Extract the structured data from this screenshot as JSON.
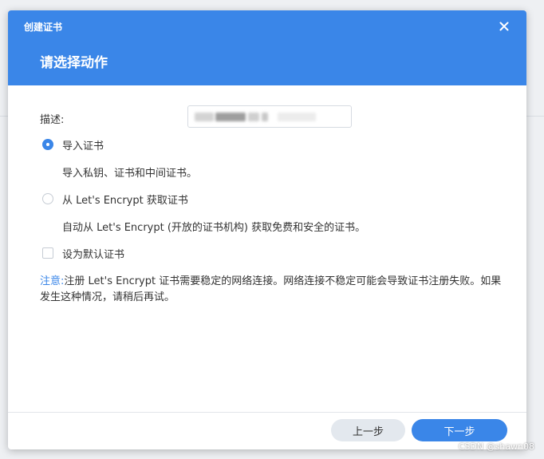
{
  "dialog": {
    "title": "创建证书",
    "subtitle": "请选择动作",
    "close_icon": "close-icon",
    "description_label": "描述:",
    "options": [
      {
        "label": "导入证书",
        "hint": "导入私钥、证书和中间证书。",
        "selected": true
      },
      {
        "label": "从 Let's Encrypt 获取证书",
        "hint": "自动从 Let's Encrypt (开放的证书机构) 获取免费和安全的证书。",
        "selected": false
      }
    ],
    "default_checkbox_label": "设为默认证书",
    "default_checked": false,
    "note_label": "注意:",
    "note_text": "注册 Let's Encrypt 证书需要稳定的网络连接。网络连接不稳定可能会导致证书注册失败。如果发生这种情况，请稍后再试。",
    "prev_button": "上一步",
    "next_button": "下一步"
  },
  "watermark": "CSDN @shawn08",
  "colors": {
    "accent": "#3a86e8",
    "secondary_button": "#e3e8ee"
  }
}
